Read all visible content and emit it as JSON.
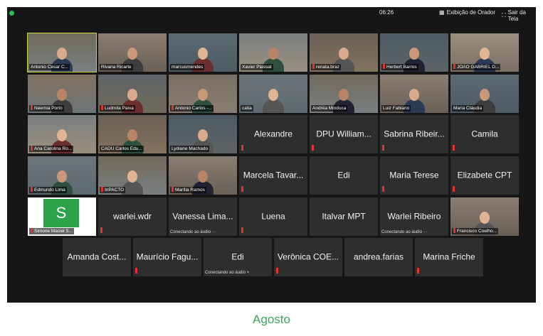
{
  "topbar": {
    "timer": "06:26",
    "speaker_view": "Exibição de Orador",
    "exit_fullscreen": "Sair da Tela"
  },
  "caption": "Agosto",
  "tiles": [
    {
      "name": "Antonio Cesar C...",
      "video": true,
      "muted": false,
      "active": true
    },
    {
      "name": "Rivana Ricarte",
      "video": true,
      "muted": false
    },
    {
      "name": "marcusmendes",
      "video": true,
      "muted": false
    },
    {
      "name": "Xavier Plassat",
      "video": true,
      "muted": false
    },
    {
      "name": "renata.braz",
      "video": true,
      "muted": true
    },
    {
      "name": "Herbert Barros",
      "video": true,
      "muted": true
    },
    {
      "name": "JOAO GABRIEL D...",
      "video": true,
      "muted": true
    },
    {
      "name": "Neemia Porto",
      "video": true,
      "muted": true
    },
    {
      "name": "Ludmila Paiva",
      "video": true,
      "muted": true
    },
    {
      "name": "Antonio Carlos -...",
      "video": true,
      "muted": true
    },
    {
      "name": "catia",
      "video": true,
      "muted": false
    },
    {
      "name": "Andréa Minduca",
      "video": true,
      "muted": false
    },
    {
      "name": "Luiz Fabiano",
      "video": true,
      "muted": false
    },
    {
      "name": "Maria Cláudia",
      "video": true,
      "muted": false
    },
    {
      "name": "Ana Carolina Ro...",
      "video": true,
      "muted": true
    },
    {
      "name": "CADU Carlos Edu...",
      "video": true,
      "muted": false
    },
    {
      "name": "Lydiane Machado",
      "video": true,
      "muted": false
    },
    {
      "name": "Alexandre",
      "video": false,
      "muted": true
    },
    {
      "name": "DPU William...",
      "video": false,
      "muted": true
    },
    {
      "name": "Sabrina Ribeir...",
      "video": false,
      "muted": true
    },
    {
      "name": "Camila",
      "video": false,
      "muted": true
    },
    {
      "name": "Edmundo Lima",
      "video": true,
      "muted": true
    },
    {
      "name": "InPACTO",
      "video": true,
      "muted": true
    },
    {
      "name": "Marília Ramos",
      "video": true,
      "muted": true
    },
    {
      "name": "Marcela Tavar...",
      "video": false,
      "muted": true
    },
    {
      "name": "Edi",
      "video": false,
      "muted": false
    },
    {
      "name": "Maria Terese",
      "video": false,
      "muted": true
    },
    {
      "name": "Elizabete CPT",
      "video": false,
      "muted": true
    },
    {
      "name": "Simone Maciel S...",
      "video": true,
      "muted": true,
      "avatar_letter": "S"
    },
    {
      "name": "warlei.wdr",
      "video": false,
      "muted": true
    },
    {
      "name": "Vanessa Lima...",
      "video": false,
      "muted": false,
      "status": "Conectando ao áudio ···"
    },
    {
      "name": "Luena",
      "video": false,
      "muted": true
    },
    {
      "name": "Italvar MPT",
      "video": false,
      "muted": false
    },
    {
      "name": "Warlei Ribeiro",
      "video": false,
      "muted": false,
      "status": "Conectando ao áudio ···"
    },
    {
      "name": "Francisco Coelho...",
      "video": true,
      "muted": true
    },
    {
      "name": "Amanda Cost...",
      "video": false,
      "muted": false
    },
    {
      "name": "Maurício Fagu...",
      "video": false,
      "muted": true
    },
    {
      "name": "Edi",
      "video": false,
      "muted": false,
      "status": "Conectando ao áudio ×"
    },
    {
      "name": "Verônica COE...",
      "video": false,
      "muted": true
    },
    {
      "name": "andrea.farias",
      "video": false,
      "muted": false
    },
    {
      "name": "Marina Friche",
      "video": false,
      "muted": true
    }
  ],
  "colors": {
    "background": "#161616",
    "tile": "#2e2e2e",
    "muted": "#e3322b",
    "active_border": "#c8d43b",
    "caption": "#3da35d",
    "live": "#23c552"
  }
}
